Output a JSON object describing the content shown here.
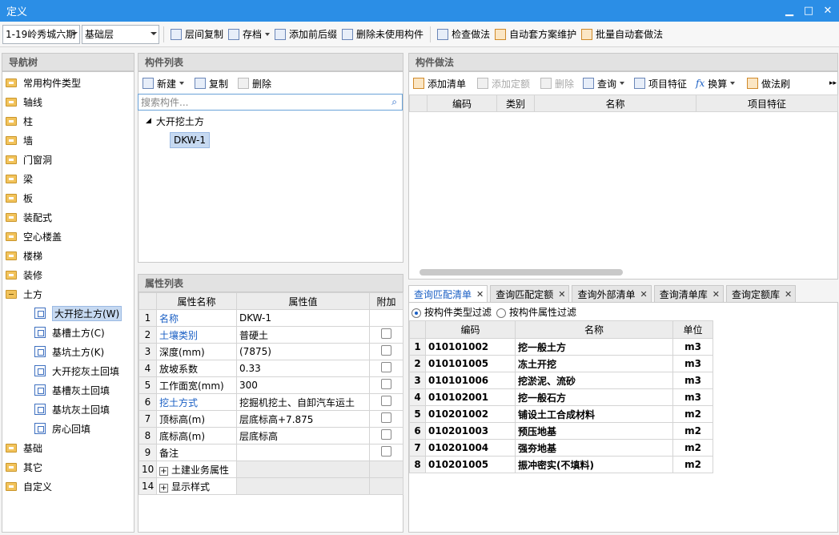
{
  "window": {
    "title": "定义"
  },
  "toolbar": {
    "project_select": "1-19岭秀城六期",
    "floor_select": "基础层",
    "buttons": [
      "层间复制",
      "存档",
      "添加前后缀",
      "删除未使用构件",
      "检查做法",
      "自动套方案维护",
      "批量自动套做法"
    ]
  },
  "nav": {
    "title": "导航树",
    "items": [
      "常用构件类型",
      "轴线",
      "柱",
      "墙",
      "门窗洞",
      "梁",
      "板",
      "装配式",
      "空心楼盖",
      "楼梯",
      "装修",
      "土方"
    ],
    "sub_items": [
      "大开挖土方(W)",
      "基槽土方(C)",
      "基坑土方(K)",
      "大开挖灰土回填",
      "基槽灰土回填",
      "基坑灰土回填",
      "房心回填"
    ],
    "tail_items": [
      "基础",
      "其它",
      "自定义"
    ]
  },
  "component_list": {
    "title": "构件列表",
    "new_label": "新建",
    "copy_label": "复制",
    "delete_label": "删除",
    "search_placeholder": "搜索构件...",
    "group": "大开挖土方",
    "item": "DKW-1"
  },
  "properties": {
    "title": "属性列表",
    "headers": [
      "属性名称",
      "属性值",
      "附加"
    ],
    "rows": [
      {
        "n": "1",
        "name": "名称",
        "value": "DKW-1"
      },
      {
        "n": "2",
        "name": "土壤类别",
        "value": "普硬土"
      },
      {
        "n": "3",
        "name": "深度(mm)",
        "value": "(7875)"
      },
      {
        "n": "4",
        "name": "放坡系数",
        "value": "0.33"
      },
      {
        "n": "5",
        "name": "工作面宽(mm)",
        "value": "300"
      },
      {
        "n": "6",
        "name": "挖土方式",
        "value": "挖掘机挖土、自卸汽车运土"
      },
      {
        "n": "7",
        "name": "顶标高(m)",
        "value": "层底标高+7.875"
      },
      {
        "n": "8",
        "name": "底标高(m)",
        "value": "层底标高"
      },
      {
        "n": "9",
        "name": "备注",
        "value": ""
      },
      {
        "n": "10",
        "name": "土建业务属性",
        "value": ""
      },
      {
        "n": "14",
        "name": "显示样式",
        "value": ""
      }
    ]
  },
  "method": {
    "title": "构件做法",
    "buttons": [
      "添加清单",
      "添加定额",
      "删除",
      "查询",
      "项目特征",
      "换算",
      "做法刷"
    ],
    "headers": [
      "编码",
      "类别",
      "名称",
      "项目特征"
    ]
  },
  "query": {
    "tabs": [
      "查询匹配清单",
      "查询匹配定额",
      "查询外部清单",
      "查询清单库",
      "查询定额库"
    ],
    "filter_type": "按构件类型过滤",
    "filter_attr": "按构件属性过滤",
    "headers": [
      "编码",
      "名称",
      "单位"
    ],
    "rows": [
      {
        "n": "1",
        "code": "010101002",
        "name": "挖一般土方",
        "unit": "m3"
      },
      {
        "n": "2",
        "code": "010101005",
        "name": "冻土开挖",
        "unit": "m3"
      },
      {
        "n": "3",
        "code": "010101006",
        "name": "挖淤泥、流砂",
        "unit": "m3"
      },
      {
        "n": "4",
        "code": "010102001",
        "name": "挖一般石方",
        "unit": "m3"
      },
      {
        "n": "5",
        "code": "010201002",
        "name": "铺设土工合成材料",
        "unit": "m2"
      },
      {
        "n": "6",
        "code": "010201003",
        "name": "预压地基",
        "unit": "m2"
      },
      {
        "n": "7",
        "code": "010201004",
        "name": "强夯地基",
        "unit": "m2"
      },
      {
        "n": "8",
        "code": "010201005",
        "name": "振冲密实(不填料)",
        "unit": "m2"
      }
    ]
  }
}
